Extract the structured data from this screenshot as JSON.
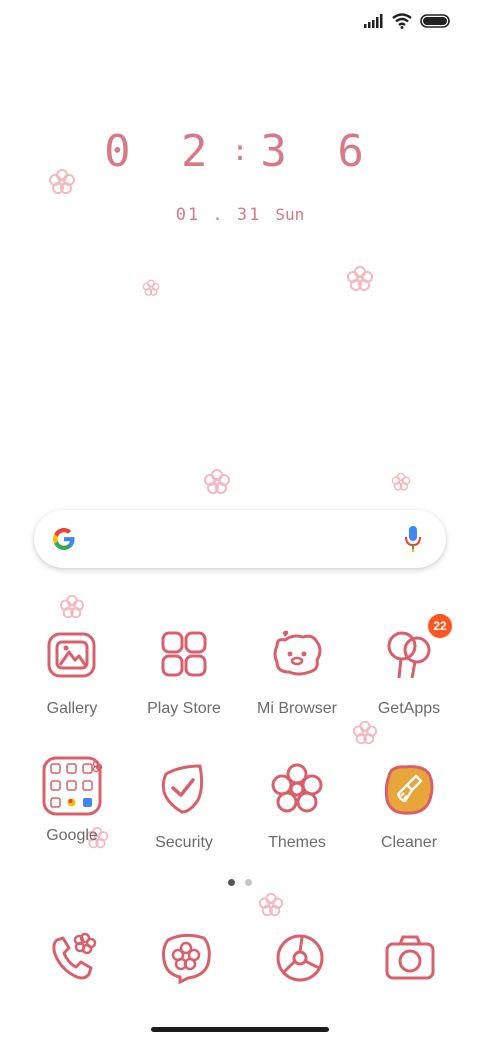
{
  "lockscreen": {
    "hour": "0 2",
    "minute": "3 6",
    "separator": ":",
    "date": "01 . 31",
    "weekday": "Sun",
    "accent_color": "#d9606b"
  },
  "status_bar": {
    "icons": [
      "signal-icon",
      "wifi-icon",
      "battery-icon"
    ]
  },
  "search_bar": {
    "logo": "google-g-icon",
    "mic": "mic-icon"
  },
  "apps_row1": [
    {
      "label": "Gallery",
      "icon": "gallery-icon"
    },
    {
      "label": "Play Store",
      "icon": "play-store-icon"
    },
    {
      "label": "Mi Browser",
      "icon": "mi-browser-icon"
    },
    {
      "label": "GetApps",
      "icon": "getapps-icon",
      "badge": "22"
    }
  ],
  "apps_row2": [
    {
      "label": "Google",
      "icon": "google-folder-icon"
    },
    {
      "label": "Security",
      "icon": "security-icon"
    },
    {
      "label": "Themes",
      "icon": "themes-icon"
    },
    {
      "label": "Cleaner",
      "icon": "cleaner-icon"
    }
  ],
  "page_indicator": {
    "pages": 2,
    "current": 1
  },
  "dock": [
    {
      "icon": "phone-icon"
    },
    {
      "icon": "messages-icon"
    },
    {
      "icon": "chrome-icon"
    },
    {
      "icon": "camera-icon"
    }
  ]
}
